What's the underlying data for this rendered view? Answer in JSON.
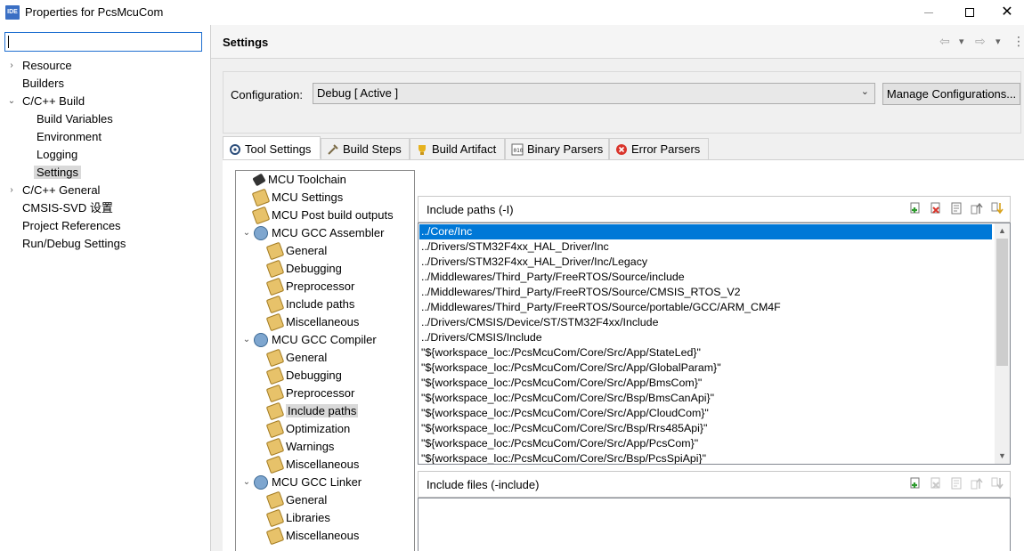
{
  "window": {
    "app_icon_text": "IDE",
    "title": "Properties for PcsMcuCom",
    "close_glyph": "✕"
  },
  "nav": {
    "filter_value": "",
    "items": [
      {
        "label": "Resource"
      },
      {
        "label": "Builders"
      },
      {
        "label": "C/C++ Build"
      },
      {
        "label": "Build Variables"
      },
      {
        "label": "Environment"
      },
      {
        "label": "Logging"
      },
      {
        "label": "Settings"
      },
      {
        "label": "C/C++ General"
      },
      {
        "label": "CMSIS-SVD 设置"
      },
      {
        "label": "Project References"
      },
      {
        "label": "Run/Debug Settings"
      }
    ],
    "selected": "Settings"
  },
  "page": {
    "title": "Settings",
    "back_icon": "⇦",
    "forward_icon": "⇨",
    "dropdown_icon": "▾",
    "menu_icon": "⋮"
  },
  "configuration": {
    "label": "Configuration:",
    "value": "Debug  [ Active ]",
    "manage_label": "Manage Configurations..."
  },
  "tabs": [
    {
      "label": "Tool Settings",
      "icon": "tool-settings-icon"
    },
    {
      "label": "Build Steps",
      "icon": "build-steps-icon"
    },
    {
      "label": "Build Artifact",
      "icon": "trophy-icon"
    },
    {
      "label": "Binary Parsers",
      "icon": "binary-icon"
    },
    {
      "label": "Error Parsers",
      "icon": "error-icon"
    }
  ],
  "tool_tree": [
    {
      "label": "MCU Toolchain"
    },
    {
      "label": "MCU Settings"
    },
    {
      "label": "MCU Post build outputs"
    },
    {
      "label": "MCU GCC Assembler"
    },
    {
      "label": "General"
    },
    {
      "label": "Debugging"
    },
    {
      "label": "Preprocessor"
    },
    {
      "label": "Include paths"
    },
    {
      "label": "Miscellaneous"
    },
    {
      "label": "MCU GCC Compiler"
    },
    {
      "label": "General"
    },
    {
      "label": "Debugging"
    },
    {
      "label": "Preprocessor"
    },
    {
      "label": "Include paths"
    },
    {
      "label": "Optimization"
    },
    {
      "label": "Warnings"
    },
    {
      "label": "Miscellaneous"
    },
    {
      "label": "MCU GCC Linker"
    },
    {
      "label": "General"
    },
    {
      "label": "Libraries"
    },
    {
      "label": "Miscellaneous"
    }
  ],
  "include_paths": {
    "title": "Include paths (-I)",
    "items": [
      "../Core/Inc",
      "../Drivers/STM32F4xx_HAL_Driver/Inc",
      "../Drivers/STM32F4xx_HAL_Driver/Inc/Legacy",
      "../Middlewares/Third_Party/FreeRTOS/Source/include",
      "../Middlewares/Third_Party/FreeRTOS/Source/CMSIS_RTOS_V2",
      "../Middlewares/Third_Party/FreeRTOS/Source/portable/GCC/ARM_CM4F",
      "../Drivers/CMSIS/Device/ST/STM32F4xx/Include",
      "../Drivers/CMSIS/Include",
      "\"${workspace_loc:/PcsMcuCom/Core/Src/App/StateLed}\"",
      "\"${workspace_loc:/PcsMcuCom/Core/Src/App/GlobalParam}\"",
      "\"${workspace_loc:/PcsMcuCom/Core/Src/App/BmsCom}\"",
      "\"${workspace_loc:/PcsMcuCom/Core/Src/Bsp/BmsCanApi}\"",
      "\"${workspace_loc:/PcsMcuCom/Core/Src/App/CloudCom}\"",
      "\"${workspace_loc:/PcsMcuCom/Core/Src/Bsp/Rrs485Api}\"",
      "\"${workspace_loc:/PcsMcuCom/Core/Src/App/PcsCom}\"",
      "\"${workspace_loc:/PcsMcuCom/Core/Src/Bsp/PcsSpiApi}\""
    ],
    "selected_index": 0
  },
  "include_files": {
    "title": "Include files (-include)"
  },
  "colors": {
    "selection": "#0078d7",
    "accent": "#1f6fd0"
  }
}
